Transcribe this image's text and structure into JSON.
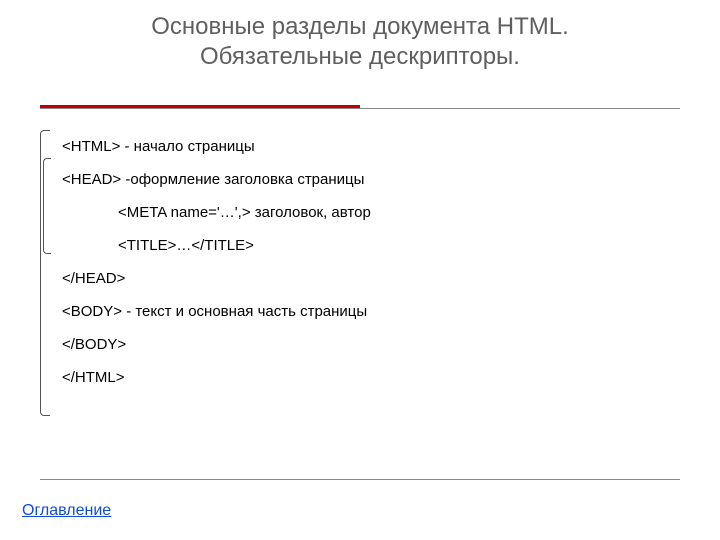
{
  "title_line1": "Основные разделы документа HTML.",
  "title_line2": "Обязательные дескрипторы.",
  "code": {
    "l1": "<HTML> - начало страницы",
    "l2": "<HEAD> -оформление заголовка страницы",
    "l3": "<META name='…',> заголовок, автор",
    "l4": "<TITLE>…</TITLE>",
    "l5": "</HEAD>",
    "l6": "<BODY> - текст и основная часть страницы",
    "l7": "</BODY>",
    "l8": "</HTML>"
  },
  "toc_label": "Оглавление"
}
